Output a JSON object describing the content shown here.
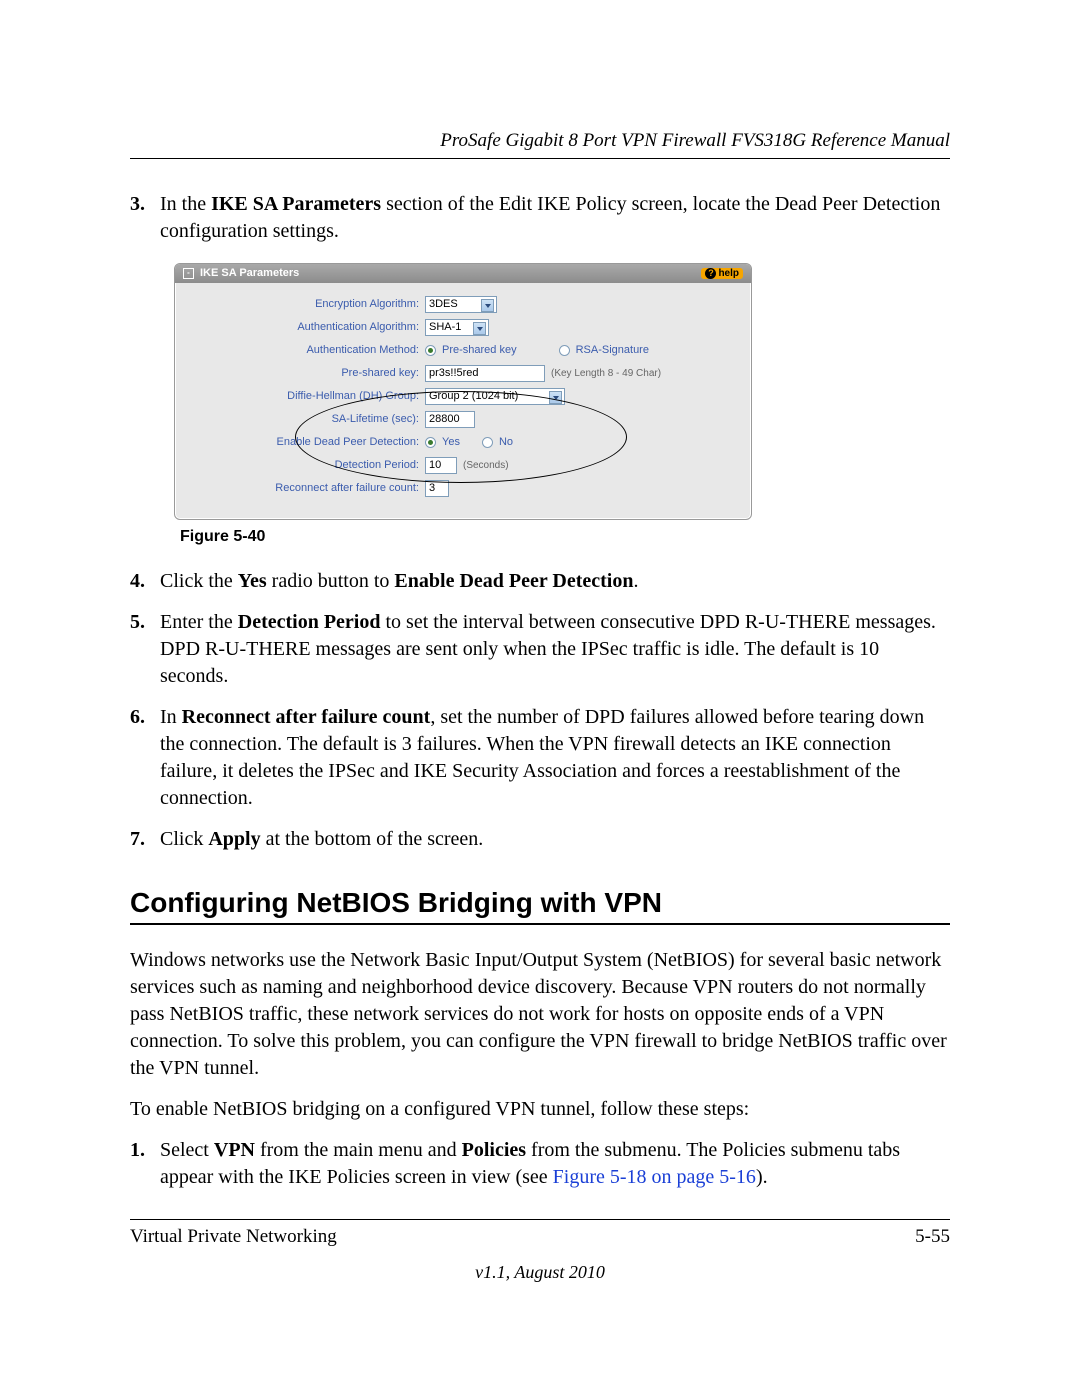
{
  "header": {
    "running": "ProSafe Gigabit 8 Port VPN Firewall FVS318G Reference Manual"
  },
  "steps1": {
    "s3": {
      "num": "3.",
      "pre": "In the ",
      "b1": "IKE SA Parameters",
      "post": " section of the Edit IKE Policy screen, locate the Dead Peer Detection configuration settings."
    },
    "s4": {
      "num": "4.",
      "pre": "Click the ",
      "b1": "Yes",
      "mid": " radio button to ",
      "b2": "Enable Dead Peer Detection",
      "post": "."
    },
    "s5": {
      "num": "5.",
      "pre": "Enter the ",
      "b1": "Detection Period",
      "post": " to set the interval between consecutive DPD R-U-THERE messages. DPD R-U-THERE messages are sent only when the IPSec traffic is idle. The default is 10 seconds."
    },
    "s6": {
      "num": "6.",
      "pre": "In ",
      "b1": "Reconnect after failure count",
      "post": ", set the number of DPD failures allowed before tearing down the connection. The default is 3 failures. When the VPN firewall detects an IKE connection failure, it deletes the IPSec and IKE Security Association and forces a reestablishment of the connection."
    },
    "s7": {
      "num": "7.",
      "pre": "Click ",
      "b1": "Apply",
      "post": " at the bottom of the screen."
    }
  },
  "figure": {
    "caption": "Figure 5-40",
    "panel_title": "IKE SA Parameters",
    "help": "help",
    "rows": {
      "enc": {
        "label": "Encryption Algorithm:",
        "value": "3DES"
      },
      "auth": {
        "label": "Authentication Algorithm:",
        "value": "SHA-1"
      },
      "meth": {
        "label": "Authentication Method:",
        "opt1": "Pre-shared key",
        "opt2": "RSA-Signature"
      },
      "psk": {
        "label": "Pre-shared key:",
        "value": "pr3s!!5red",
        "hint": "(Key Length 8 - 49 Char)"
      },
      "dh": {
        "label": "Diffie-Hellman (DH) Group:",
        "value": "Group 2 (1024 bit)"
      },
      "life": {
        "label": "SA-Lifetime (sec):",
        "value": "28800"
      },
      "dpd": {
        "label": "Enable Dead Peer Detection:",
        "yes": "Yes",
        "no": "No"
      },
      "per": {
        "label": "Detection Period:",
        "value": "10",
        "hint": "(Seconds)"
      },
      "rec": {
        "label": "Reconnect after failure count:",
        "value": "3"
      }
    }
  },
  "h2": "Configuring NetBIOS Bridging with VPN",
  "para1": "Windows networks use the Network Basic Input/Output System (NetBIOS) for several basic network services such as naming and neighborhood device discovery. Because VPN routers do not normally pass NetBIOS traffic, these network services do not work for hosts on opposite ends of a VPN connection. To solve this problem, you can configure the VPN firewall to bridge NetBIOS traffic over the VPN tunnel.",
  "para2": "To enable NetBIOS bridging on a configured VPN tunnel, follow these steps:",
  "steps2": {
    "s1": {
      "num": "1.",
      "pre": "Select ",
      "b1": "VPN",
      "mid1": " from the main menu and ",
      "b2": "Policies",
      "mid2": " from the submenu. The Policies submenu tabs appear with the IKE Policies screen in view (see ",
      "link": "Figure 5-18 on page 5-16",
      "post": ")."
    }
  },
  "footer": {
    "left": "Virtual Private Networking",
    "right": "5-55",
    "version": "v1.1, August 2010"
  }
}
